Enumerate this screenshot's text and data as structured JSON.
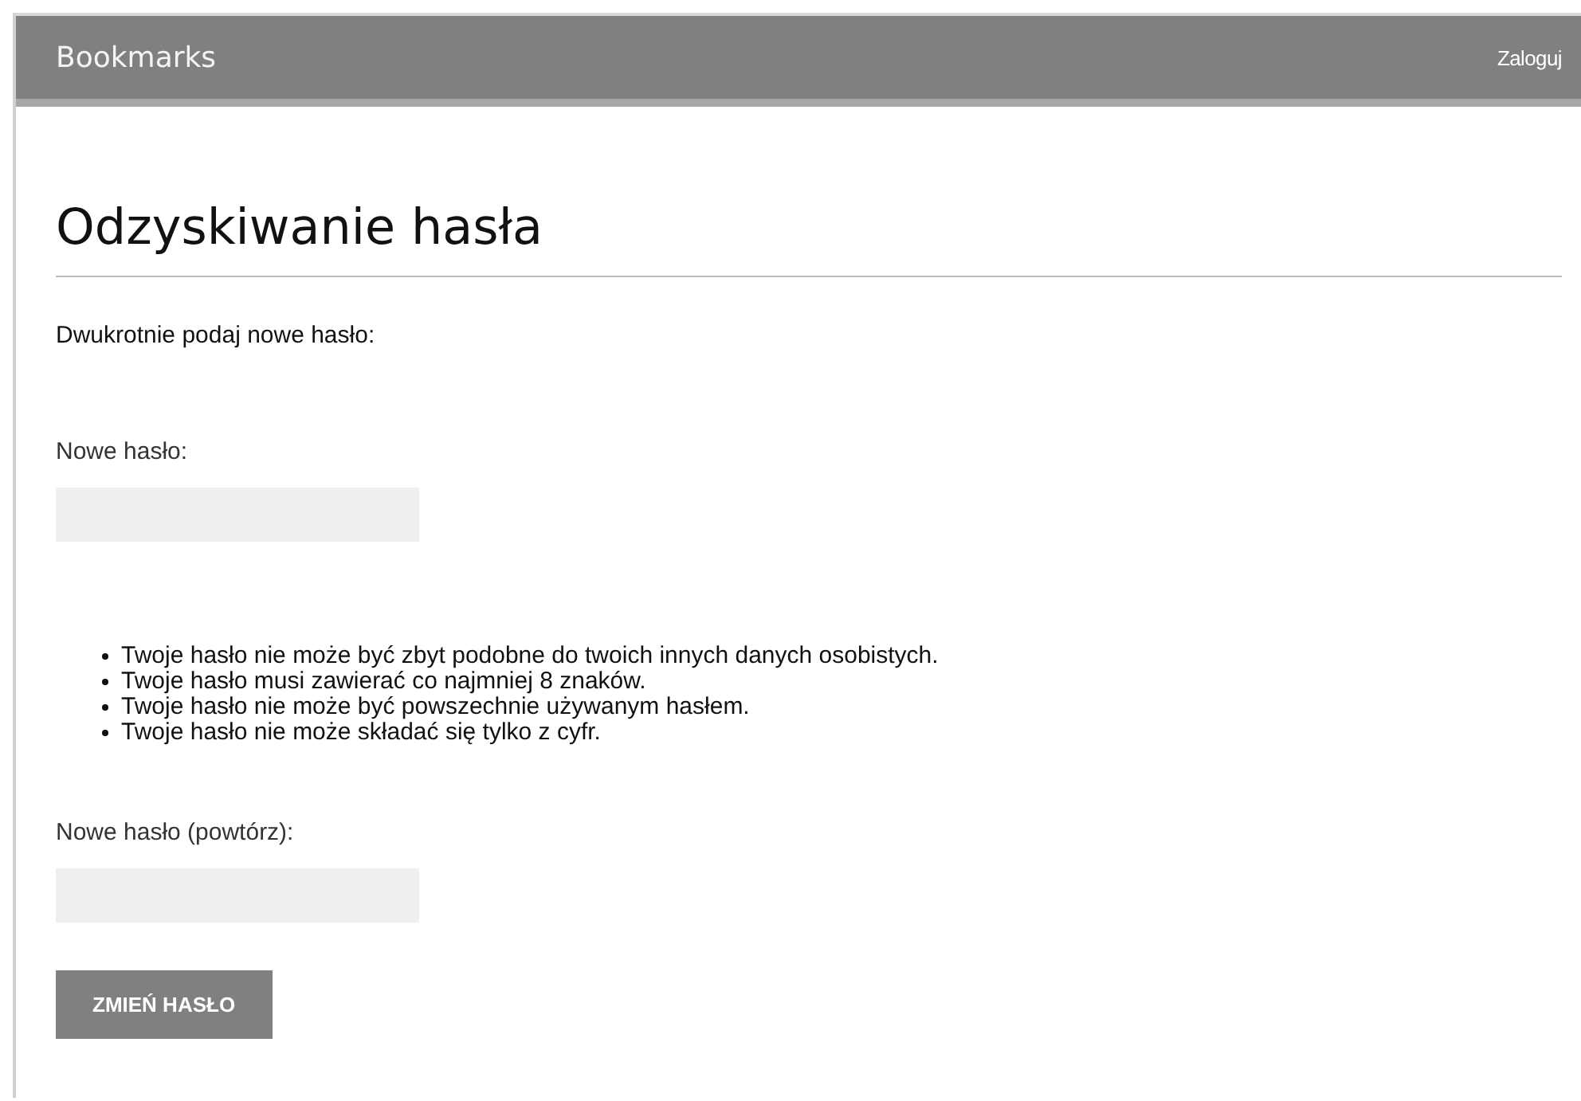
{
  "header": {
    "brand": "Bookmarks",
    "login_link": "Zaloguj"
  },
  "page": {
    "title": "Odzyskiwanie hasła",
    "intro": "Dwukrotnie podaj nowe hasło:"
  },
  "fields": [
    {
      "label": "Nowe hasło:"
    },
    {
      "label": "Nowe hasło (powtórz):"
    }
  ],
  "help_items": [
    "Twoje hasło nie może być zbyt podobne do twoich innych danych osobistych.",
    "Twoje hasło musi zawierać co najmniej 8 znaków.",
    "Twoje hasło nie może być powszechnie używanym hasłem.",
    "Twoje hasło nie może składać się tylko z cyfr."
  ],
  "submit_button": "ZMIEŃ HASŁO"
}
